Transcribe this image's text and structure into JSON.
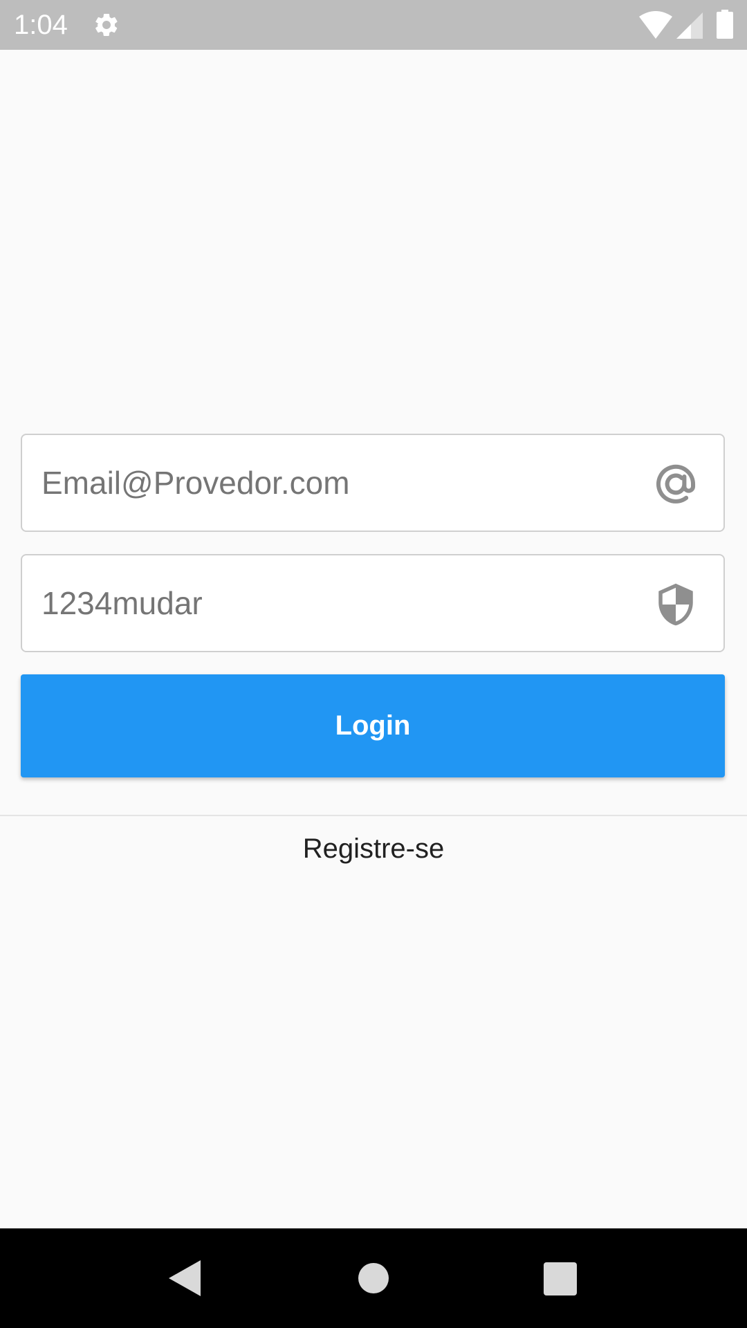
{
  "status_bar": {
    "time": "1:04",
    "icons": [
      "gear-icon",
      "wifi-icon",
      "signal-icon",
      "battery-icon"
    ]
  },
  "login_form": {
    "email": {
      "placeholder": "Email@Provedor.com",
      "value": "",
      "icon": "at-sign-icon"
    },
    "password": {
      "placeholder": "1234mudar",
      "value": "",
      "icon": "shield-icon"
    },
    "login_label": "Login",
    "register_label": "Registre-se"
  },
  "navigation_bar": {
    "icons": [
      "back-icon",
      "home-icon",
      "recents-icon"
    ]
  },
  "colors": {
    "accent": "#2196f3",
    "status_bar": "#bdbdbd",
    "background": "#fafafa",
    "nav_bar": "#000000"
  }
}
